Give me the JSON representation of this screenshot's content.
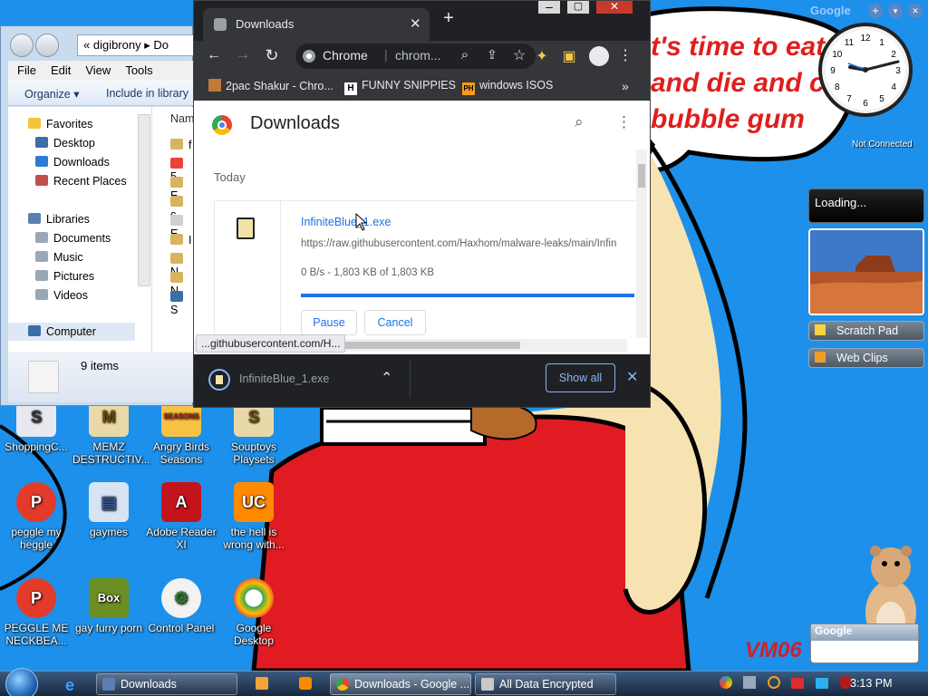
{
  "desktop": {
    "bubble_lines": [
      "t's time to eat",
      "and die and c",
      "bubble gum"
    ],
    "watermark": "VM06",
    "icons": [
      {
        "label": "ShoppingC...",
        "icon": "shopping-icon"
      },
      {
        "label": "MEMZ DESTRUCTIV...",
        "icon": "memz-icon"
      },
      {
        "label": "Angry Birds Seasons",
        "icon": "angry-birds-icon"
      },
      {
        "label": "Souptoys Playsets",
        "icon": "souptoys-icon"
      },
      {
        "label": "peggle my heggle",
        "icon": "peggle-icon"
      },
      {
        "label": "gaymes",
        "icon": "folder-icon"
      },
      {
        "label": "Adobe Reader XI",
        "icon": "adobe-reader-icon"
      },
      {
        "label": "the hell is wrong with...",
        "icon": "uc-browser-icon"
      },
      {
        "label": "PEGGLE ME NECKBEA...",
        "icon": "peggle-icon"
      },
      {
        "label": "gay furry porn",
        "icon": "box-icon"
      },
      {
        "label": "Control Panel",
        "icon": "control-panel-icon"
      },
      {
        "label": "Google Desktop",
        "icon": "google-desktop-icon"
      }
    ],
    "box_icon_text": "Box",
    "angry_birds_badge": "SEASONS"
  },
  "explorer": {
    "address": "« digibrony ▸ Do",
    "menu": [
      "File",
      "Edit",
      "View",
      "Tools",
      "Help"
    ],
    "organize": "Organize ▾",
    "include_in_library": "Include in library",
    "column_name": "Nam",
    "favorites_header": "Favorites",
    "favorites": [
      "Desktop",
      "Downloads",
      "Recent Places"
    ],
    "libraries_header": "Libraries",
    "libraries": [
      "Documents",
      "Music",
      "Pictures",
      "Videos"
    ],
    "computer": "Computer",
    "file_initials": [
      "f",
      "5",
      "E",
      "c",
      "E",
      "I",
      "N",
      "N",
      "S"
    ],
    "status_count": "9 items"
  },
  "chrome": {
    "tab_title": "Downloads",
    "omnibox_site": "Chrome",
    "omnibox_url": "chrom...",
    "bookmarks": [
      {
        "label": "2pac Shakur - Chro...",
        "icon": "bookmark-2pac-icon"
      },
      {
        "label": "FUNNY SNIPPIES",
        "icon": "bookmark-h-icon"
      },
      {
        "label": "windows ISOS",
        "icon": "bookmark-ph-icon"
      }
    ],
    "bookmark_h": "H",
    "bookmark_ph": "PH",
    "page_title": "Downloads",
    "section_date": "Today",
    "download": {
      "filename": "InfiniteBlue_1.exe",
      "url": "https://raw.githubusercontent.com/Haxhom/malware-leaks/main/Infin",
      "status": "0 B/s - 1,803 KB of 1,803 KB",
      "progress": 1.0,
      "pause_label": "Pause",
      "cancel_label": "Cancel"
    },
    "status_tooltip": "...githubusercontent.com/H...",
    "shelf_filename": "InfiniteBlue_1.exe",
    "show_all": "Show all",
    "accent": "#1a73e8"
  },
  "gadgets": {
    "clock_label": "Not Connected",
    "clock_numbers": [
      "12",
      "1",
      "2",
      "3",
      "4",
      "5",
      "6",
      "7",
      "8",
      "9",
      "10",
      "11"
    ],
    "google_label": "Google",
    "loading": "Loading...",
    "scratch_pad": "Scratch Pad",
    "web_clips": "Web Clips"
  },
  "taskbar": {
    "buttons": [
      "Downloads",
      "Downloads - Google ...",
      "All Data Encrypted"
    ],
    "time": "3:13 PM"
  }
}
